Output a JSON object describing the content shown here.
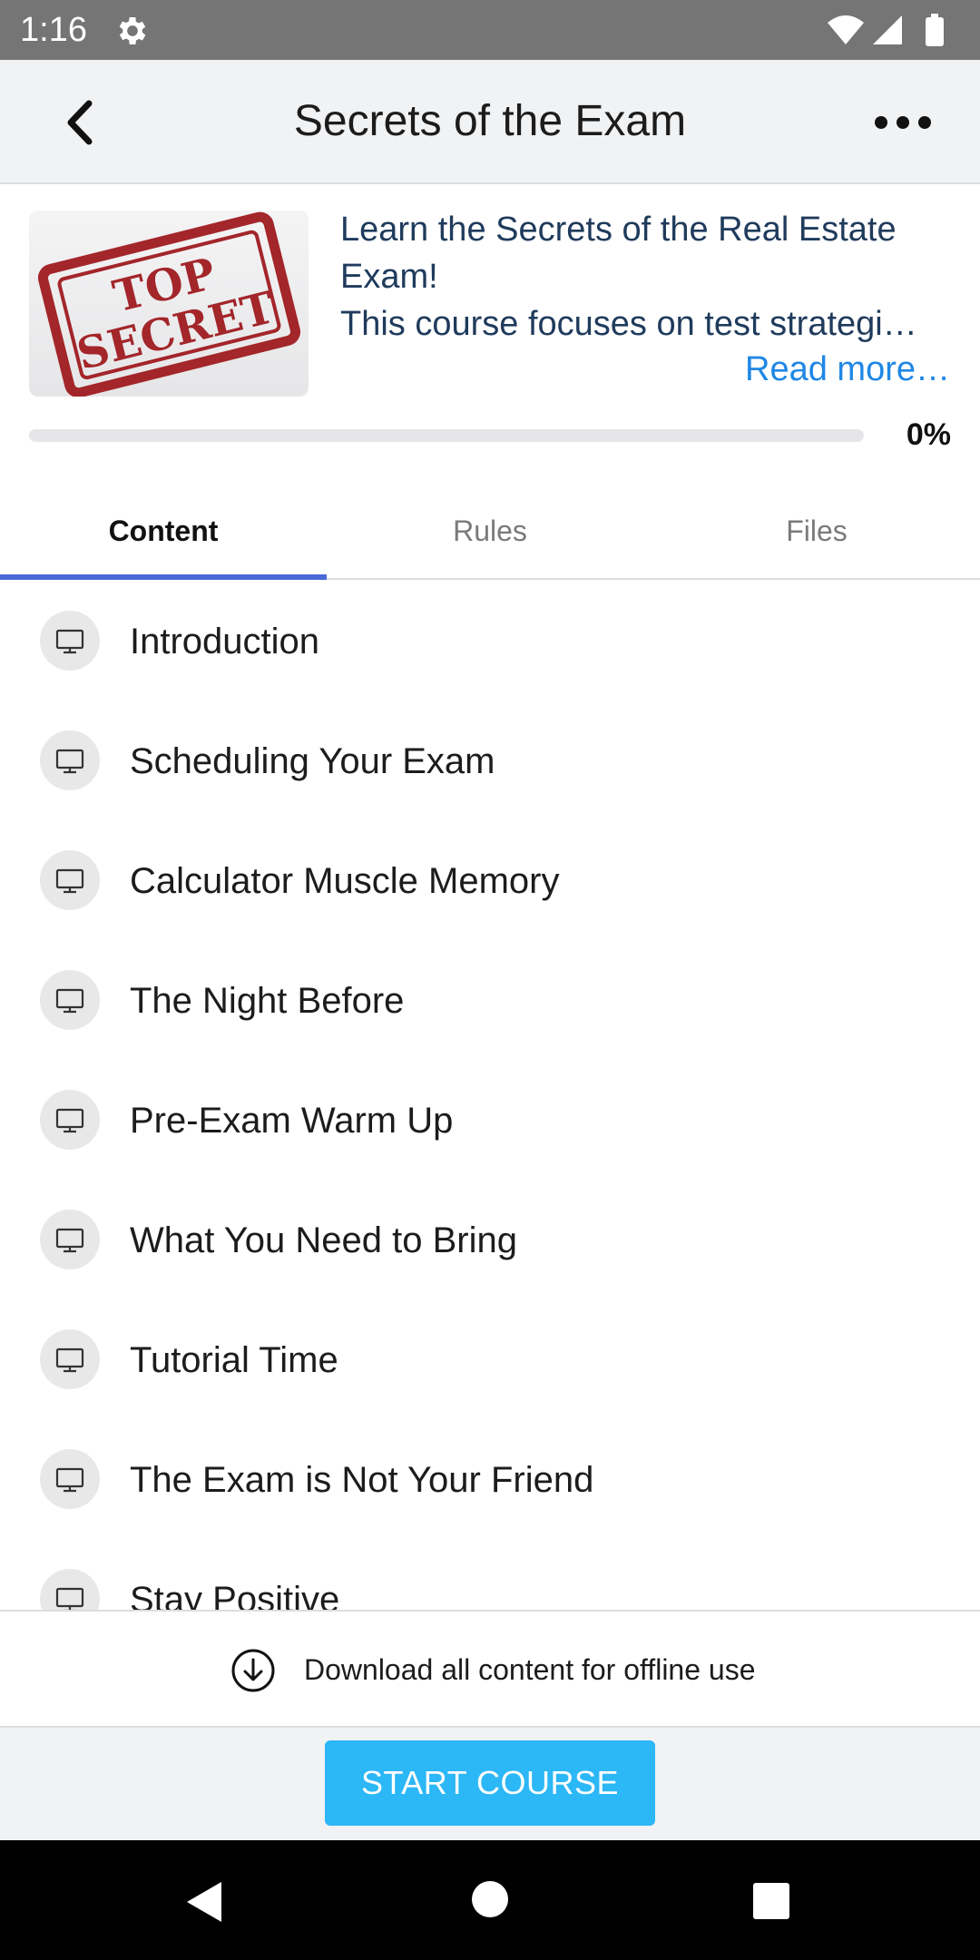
{
  "status_bar": {
    "time": "1:16",
    "icons": [
      "gear-icon",
      "wifi-icon",
      "signal-icon",
      "battery-icon"
    ]
  },
  "app_bar": {
    "title": "Secrets of the Exam",
    "back_icon": "chevron-left-icon",
    "more_icon": "more-horizontal-icon"
  },
  "course": {
    "image_icon": "top-secret-stamp",
    "image_text_line1": "TOP",
    "image_text_line2": "SECRET",
    "description_line1": "Learn the Secrets of the Real Estate",
    "description_line2": "Exam!",
    "description_line3": "This course focuses on test strategi…",
    "read_more": "Read more…",
    "progress_label": "0%",
    "progress_value": 0
  },
  "tabs": [
    {
      "label": "Content",
      "active": true
    },
    {
      "label": "Rules",
      "active": false
    },
    {
      "label": "Files",
      "active": false
    }
  ],
  "lessons": [
    {
      "label": "Introduction",
      "icon": "monitor-icon"
    },
    {
      "label": "Scheduling Your Exam",
      "icon": "monitor-icon"
    },
    {
      "label": "Calculator Muscle Memory",
      "icon": "monitor-icon"
    },
    {
      "label": "The Night Before",
      "icon": "monitor-icon"
    },
    {
      "label": "Pre-Exam Warm Up",
      "icon": "monitor-icon"
    },
    {
      "label": "What You Need to Bring",
      "icon": "monitor-icon"
    },
    {
      "label": "Tutorial Time",
      "icon": "monitor-icon"
    },
    {
      "label": "The Exam is Not Your Friend",
      "icon": "monitor-icon"
    },
    {
      "label": "Stay Positive",
      "icon": "monitor-icon"
    }
  ],
  "download": {
    "label": "Download all content for offline use",
    "icon": "download-circle-icon"
  },
  "footer": {
    "start_label": "START COURSE"
  },
  "colors": {
    "status_bar": "#757575",
    "app_bar": "#f1f2f4",
    "accent_link": "#1f87e5",
    "tab_indicator": "#4a67d6",
    "start_button": "#2cb7f6",
    "description_text": "#1f3b5c"
  }
}
